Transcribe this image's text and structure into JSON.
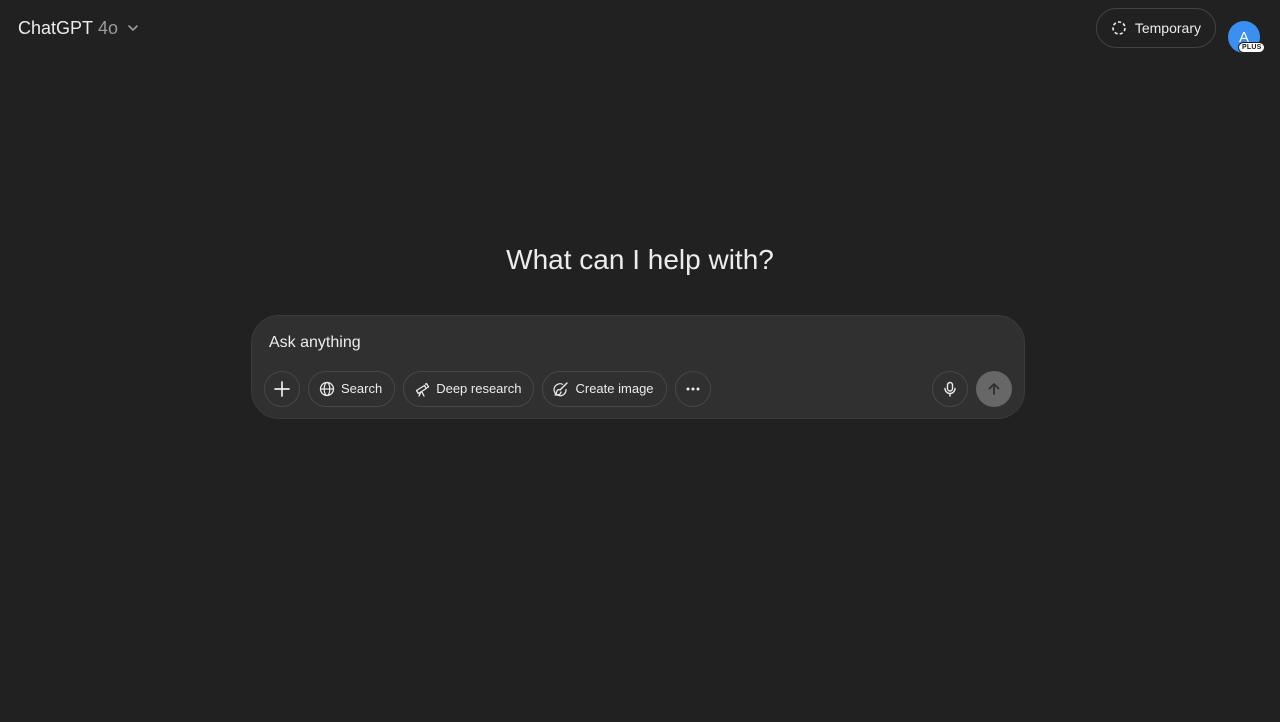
{
  "header": {
    "model_name": "ChatGPT",
    "model_version": "4o",
    "temporary_label": "Temporary",
    "avatar_initial": "A",
    "plan_badge": "PLUS"
  },
  "main": {
    "headline": "What can I help with?"
  },
  "composer": {
    "placeholder": "Ask anything",
    "tools": {
      "search_label": "Search",
      "deep_research_label": "Deep research",
      "create_image_label": "Create image"
    }
  },
  "icons": {
    "model_chevron": "chevron-down-icon",
    "temporary": "dashed-circle-icon",
    "attach": "plus-icon",
    "search": "globe-icon",
    "deep_research": "telescope-icon",
    "create_image": "paintbrush-icon",
    "more": "ellipsis-icon",
    "voice": "microphone-icon",
    "send": "arrow-up-icon"
  },
  "colors": {
    "background": "#212121",
    "composer_bg": "#303030",
    "avatar_bg": "#3b8ff0",
    "send_bg": "#676767"
  }
}
